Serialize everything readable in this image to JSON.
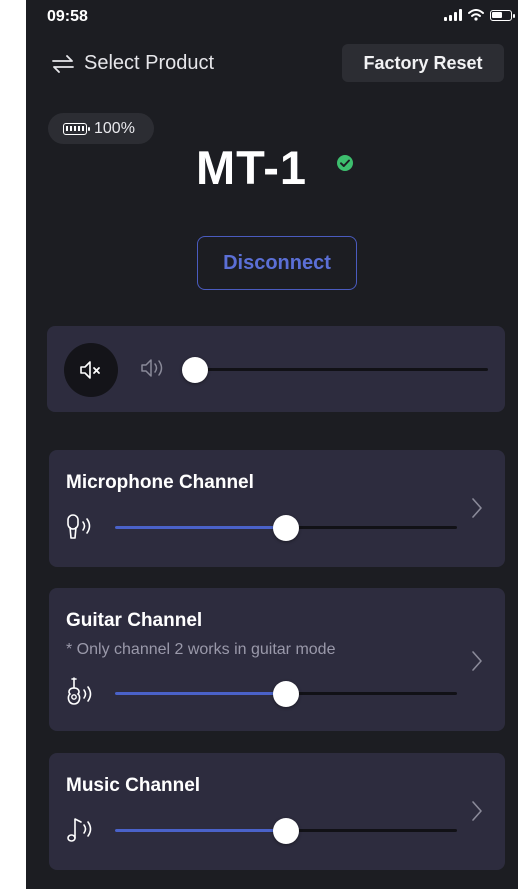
{
  "status_bar": {
    "time": "09:58"
  },
  "header": {
    "select_product": "Select Product",
    "factory_reset": "Factory Reset"
  },
  "device": {
    "battery": "100%",
    "name": "MT-1",
    "connected": true,
    "disconnect": "Disconnect"
  },
  "master_volume": {
    "level": 0.0,
    "muted": true
  },
  "channels": [
    {
      "title": "Microphone Channel",
      "note": "",
      "level": 0.5,
      "icon": "microphone-icon"
    },
    {
      "title": "Guitar Channel",
      "note": "* Only channel 2 works in guitar mode",
      "level": 0.5,
      "icon": "guitar-icon"
    },
    {
      "title": "Music Channel",
      "note": "",
      "level": 0.5,
      "icon": "music-note-icon"
    }
  ],
  "colors": {
    "background": "#1c1d22",
    "card": "#2d2c3e",
    "accent": "#4a62c9",
    "connected": "#3dbe6e"
  }
}
